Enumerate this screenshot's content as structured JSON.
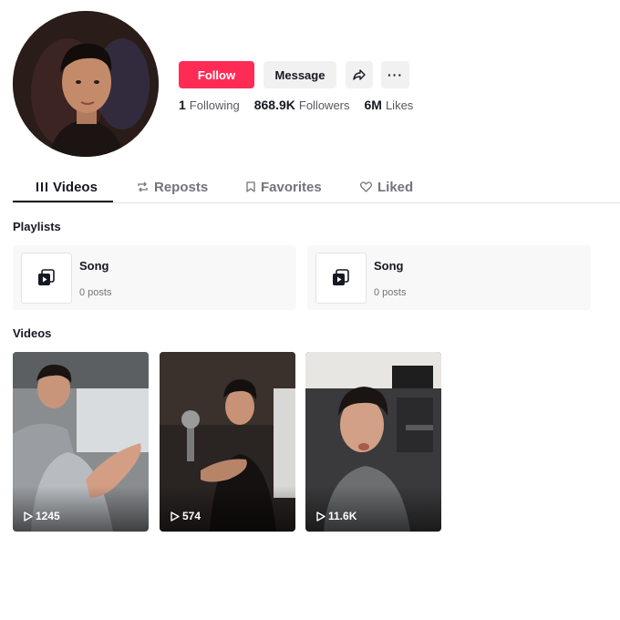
{
  "profile": {
    "follow_label": "Follow",
    "message_label": "Message",
    "share_icon": "share-arrow-icon",
    "more_label": "···",
    "stats": [
      {
        "value": "1",
        "label": "Following"
      },
      {
        "value": "868.9K",
        "label": "Followers"
      },
      {
        "value": "6M",
        "label": "Likes"
      }
    ]
  },
  "tabs": [
    {
      "label": "Videos",
      "icon": "grid-icon",
      "active": true
    },
    {
      "label": "Reposts",
      "icon": "repost-icon",
      "active": false
    },
    {
      "label": "Favorites",
      "icon": "bookmark-icon",
      "active": false
    },
    {
      "label": "Liked",
      "icon": "heart-icon",
      "active": false
    }
  ],
  "playlists": {
    "heading": "Playlists",
    "items": [
      {
        "title": "Song",
        "count": "0 posts"
      },
      {
        "title": "Song",
        "count": "0 posts"
      }
    ]
  },
  "videos": {
    "heading": "Videos",
    "items": [
      {
        "views": "1245"
      },
      {
        "views": "574"
      },
      {
        "views": "11.6K"
      }
    ]
  },
  "colors": {
    "accent": "#fe2c55",
    "text": "#161823",
    "muted": "#73747b",
    "button_bg": "#f1f1f2"
  }
}
